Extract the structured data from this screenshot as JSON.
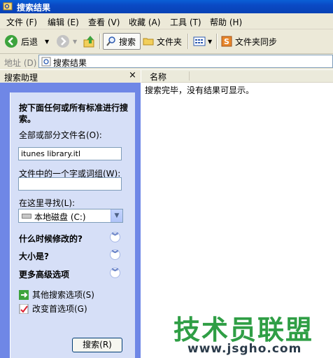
{
  "window": {
    "title": "搜索结果"
  },
  "menu": [
    "文件 (F)",
    "编辑 (E)",
    "查看 (V)",
    "收藏 (A)",
    "工具 (T)",
    "帮助 (H)"
  ],
  "toolbar": {
    "back": "后退",
    "search": "搜索",
    "folders": "文件夹",
    "folder_sync": "文件夹同步"
  },
  "address": {
    "label": "地址 (D)",
    "value": "搜索结果"
  },
  "assistant": {
    "title": "搜索助理",
    "close": "×",
    "heading": "按下面任何或所有标准进行搜索。",
    "filename_label": "全部或部分文件名(O):",
    "filename_value": "itunes library.itl",
    "phrase_label": "文件中的一个字或词组(W):",
    "phrase_value": "",
    "lookin_label": "在这里寻找(L):",
    "lookin_value": "本地磁盘 (C:)",
    "expanders": [
      "什么时候修改的?",
      "大小是?",
      "更多高级选项"
    ],
    "links": [
      "其他搜索选项(S)",
      "改变首选项(G)"
    ],
    "search_button": "搜索(R)"
  },
  "results": {
    "column_name": "名称",
    "message": "搜索完毕，没有结果可显示。"
  },
  "watermark": {
    "text": "技术员联盟",
    "url": "www.jsgho.com"
  },
  "colors": {
    "title_blue": "#0a49c4",
    "pane_blue": "#6f87e6",
    "card_bg": "#d6dff7",
    "watermark_green": "#2f9e45"
  }
}
